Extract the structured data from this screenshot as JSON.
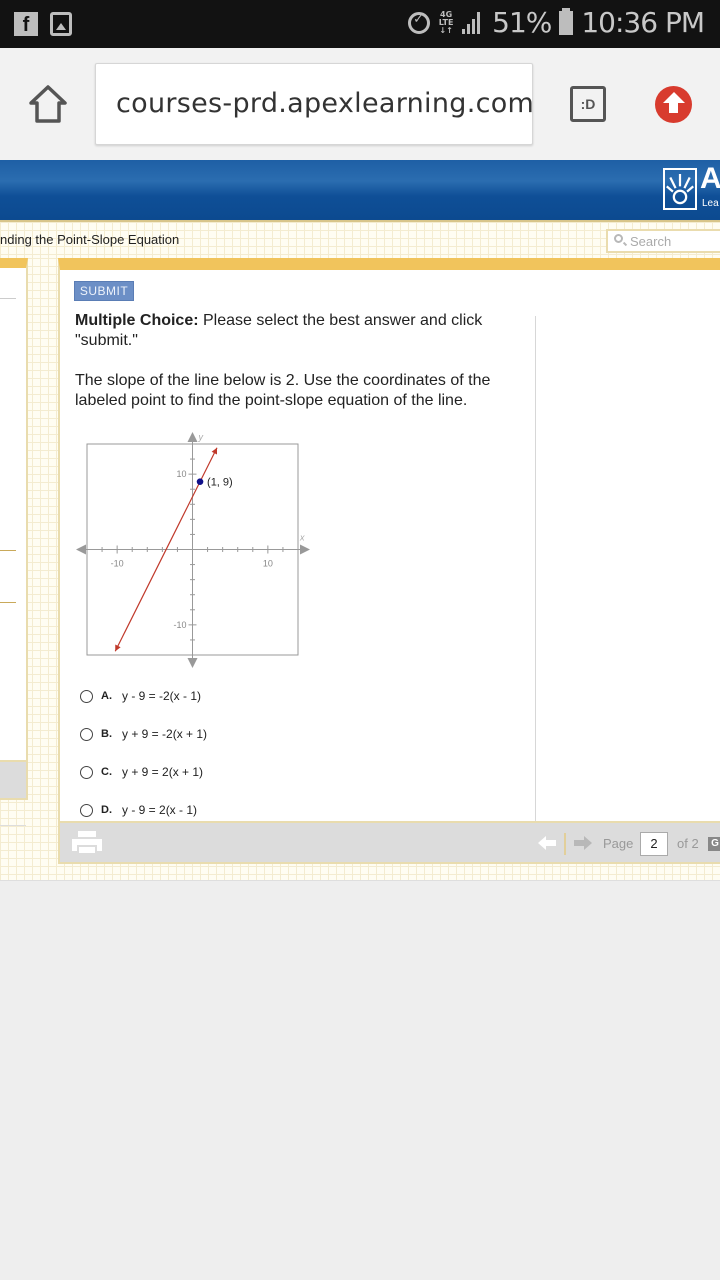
{
  "status_bar": {
    "left_icons": [
      "facebook-icon",
      "gallery-icon"
    ],
    "right_icons": [
      "alarm-icon",
      "4g-lte-icon",
      "signal-icon",
      "battery-charging-icon"
    ],
    "network": "4G LTE",
    "battery_percent": "51%",
    "time": "10:36 PM"
  },
  "browser": {
    "url": "courses-prd.apexlearning.com/",
    "tab_button_label": ":D",
    "home_icon": "home-icon",
    "menu_icon": "upload-arrow-icon"
  },
  "apex": {
    "logo_text": "A",
    "logo_sub": "Lea",
    "lesson_title": "nding the Point-Slope Equation",
    "search_placeholder": "Search"
  },
  "question": {
    "submit_label": "SUBMIT",
    "instruction_bold": "Multiple Choice:",
    "instruction_rest": " Please select the best answer and click \"submit.\"",
    "prompt": "The slope of the line below is 2. Use the coordinates of the labeled point to find the point-slope equation of the line.",
    "choices": [
      {
        "letter": "A.",
        "equation": "y - 9 = -2(x - 1)"
      },
      {
        "letter": "B.",
        "equation": "y + 9 = -2(x + 1)"
      },
      {
        "letter": "C.",
        "equation": "y + 9 = 2(x + 1)"
      },
      {
        "letter": "D.",
        "equation": "y - 9 = 2(x - 1)"
      }
    ]
  },
  "graph": {
    "x_axis_label": "x",
    "y_axis_label": "y",
    "x_range": [
      -14,
      14
    ],
    "y_range": [
      -14,
      14
    ],
    "tick_labels": {
      "x_neg": "-10",
      "x_pos": "10",
      "y_pos": "10",
      "y_neg": "-10"
    },
    "line": {
      "slope": 2,
      "point": [
        1,
        9
      ],
      "color": "#c0392b"
    },
    "point_label": "(1, 9)",
    "point_color": "#10108a"
  },
  "footer": {
    "page_label": "Page",
    "page_value": "2",
    "page_of": "of 2",
    "go_label": "G"
  }
}
